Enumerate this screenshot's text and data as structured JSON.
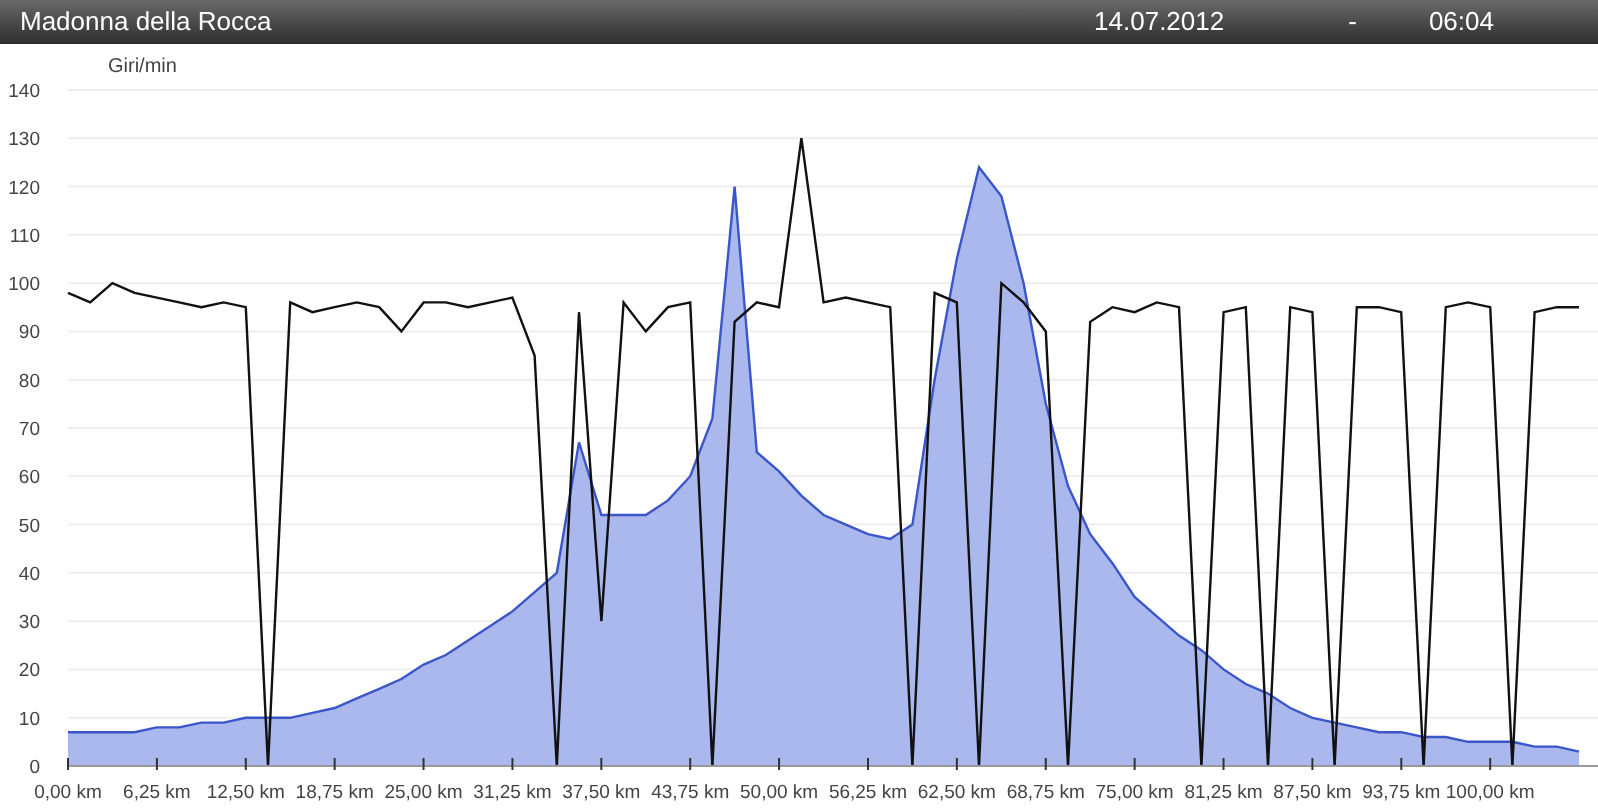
{
  "window": {
    "title": "Madonna della Rocca",
    "date": "14.07.2012",
    "separator": "-",
    "time": "06:04"
  },
  "chart": {
    "chart_data": {
      "type": "area",
      "grid": true,
      "ylabel": "Giri/min",
      "xlim": [
        0,
        107.3
      ],
      "ylim": [
        0,
        140
      ],
      "yticks": [
        0,
        10,
        20,
        30,
        40,
        50,
        60,
        70,
        80,
        90,
        100,
        110,
        120,
        130,
        140
      ],
      "xticks": [
        {
          "value": 0,
          "label": "0,00 km"
        },
        {
          "value": 6.25,
          "label": "6,25 km"
        },
        {
          "value": 12.5,
          "label": "12,50 km"
        },
        {
          "value": 18.75,
          "label": "18,75 km"
        },
        {
          "value": 25,
          "label": "25,00 km"
        },
        {
          "value": 31.25,
          "label": "31,25 km"
        },
        {
          "value": 37.5,
          "label": "37,50 km"
        },
        {
          "value": 43.75,
          "label": "43,75 km"
        },
        {
          "value": 50,
          "label": "50,00 km"
        },
        {
          "value": 56.25,
          "label": "56,25 km"
        },
        {
          "value": 62.5,
          "label": "62,50 km"
        },
        {
          "value": 68.75,
          "label": "68,75 km"
        },
        {
          "value": 75,
          "label": "75,00 km"
        },
        {
          "value": 81.25,
          "label": "81,25 km"
        },
        {
          "value": 87.5,
          "label": "87,50 km"
        },
        {
          "value": 93.75,
          "label": "93,75 km"
        },
        {
          "value": 100,
          "label": "100,00 km"
        }
      ],
      "x": [
        0,
        1.5625,
        3.125,
        4.6875,
        6.25,
        7.8125,
        9.375,
        10.9375,
        12.5,
        14.0625,
        15.625,
        17.1875,
        18.75,
        20.3125,
        21.875,
        23.4375,
        25,
        26.5625,
        28.125,
        29.6875,
        31.25,
        32.8125,
        34.375,
        35.9375,
        37.5,
        39.0625,
        40.625,
        42.1875,
        43.75,
        45.3125,
        46.875,
        48.4375,
        50,
        51.5625,
        53.125,
        54.6875,
        56.25,
        57.8125,
        59.375,
        60.9375,
        62.5,
        64.0625,
        65.625,
        67.1875,
        68.75,
        70.3125,
        71.875,
        73.4375,
        75,
        76.5625,
        78.125,
        79.6875,
        81.25,
        82.8125,
        84.375,
        85.9375,
        87.5,
        89.0625,
        90.625,
        92.1875,
        93.75,
        95.3125,
        96.875,
        98.4375,
        100,
        101.5625,
        103.125,
        104.6875,
        106.25
      ],
      "series": [
        {
          "color": "#3a56c8",
          "values": [
            7,
            7,
            7,
            7,
            8,
            8,
            9,
            9,
            10,
            10,
            10,
            11,
            12,
            14,
            16,
            18,
            21,
            23,
            26,
            29,
            32,
            36,
            40,
            67,
            52,
            52,
            52,
            55,
            60,
            72,
            120,
            65,
            61,
            56,
            52,
            50,
            48,
            47,
            50,
            80,
            105,
            124,
            118,
            100,
            75,
            58,
            48,
            42,
            35,
            31,
            27,
            24,
            20,
            17,
            15,
            12,
            10,
            9,
            8,
            7,
            7,
            6,
            6,
            5,
            5,
            5,
            4,
            4,
            3
          ]
        },
        {
          "type": "line",
          "color": "#111111",
          "values": [
            98,
            96,
            100,
            98,
            97,
            96,
            95,
            96,
            95,
            0,
            96,
            94,
            95,
            96,
            95,
            90,
            96,
            96,
            95,
            96,
            97,
            85,
            0,
            94,
            30,
            96,
            90,
            95,
            96,
            0,
            92,
            96,
            95,
            130,
            96,
            97,
            96,
            95,
            0,
            98,
            96,
            0,
            100,
            96,
            90,
            0,
            92,
            95,
            94,
            96,
            95,
            0,
            94,
            95,
            0,
            95,
            94,
            0,
            95,
            95,
            94,
            0,
            95,
            96,
            95,
            0,
            94,
            95,
            95
          ]
        }
      ]
    }
  }
}
